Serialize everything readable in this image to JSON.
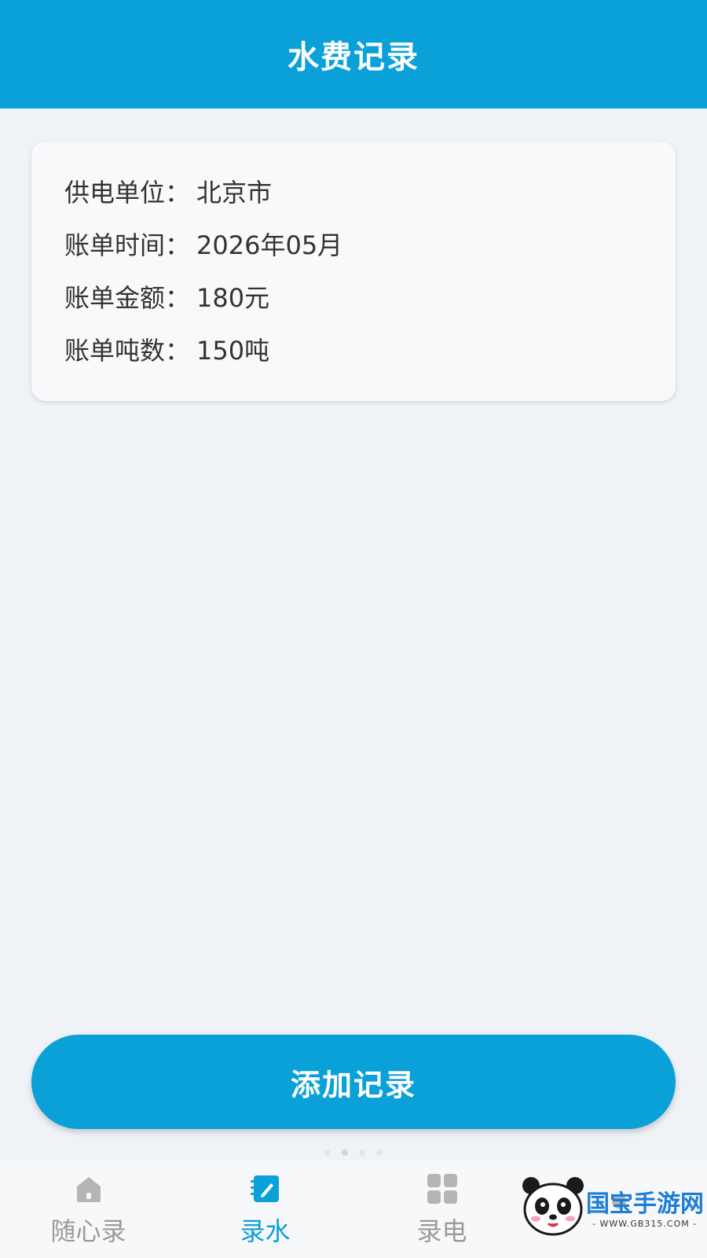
{
  "header": {
    "title": "水费记录"
  },
  "record": {
    "rows": [
      {
        "label": "供电单位：",
        "value": "北京市"
      },
      {
        "label": "账单时间：",
        "value": "2026年05月"
      },
      {
        "label": "账单金额：",
        "value": "180元"
      },
      {
        "label": "账单吨数：",
        "value": "150吨"
      }
    ]
  },
  "actions": {
    "add_label": "添加记录"
  },
  "tabbar": {
    "tabs": [
      {
        "label": "随心录",
        "icon": "home-icon",
        "active": false
      },
      {
        "label": "录水",
        "icon": "edit-note-icon",
        "active": true
      },
      {
        "label": "录电",
        "icon": "grid-icon",
        "active": false
      },
      {
        "label": "",
        "icon": "profile-icon",
        "active": false
      }
    ]
  },
  "watermark": {
    "brand": "国宝手游网",
    "url": "- WWW.GB315.COM -"
  },
  "colors": {
    "primary": "#0aa0d8",
    "background": "#eff2f6",
    "inactive": "#9b9b9b"
  }
}
